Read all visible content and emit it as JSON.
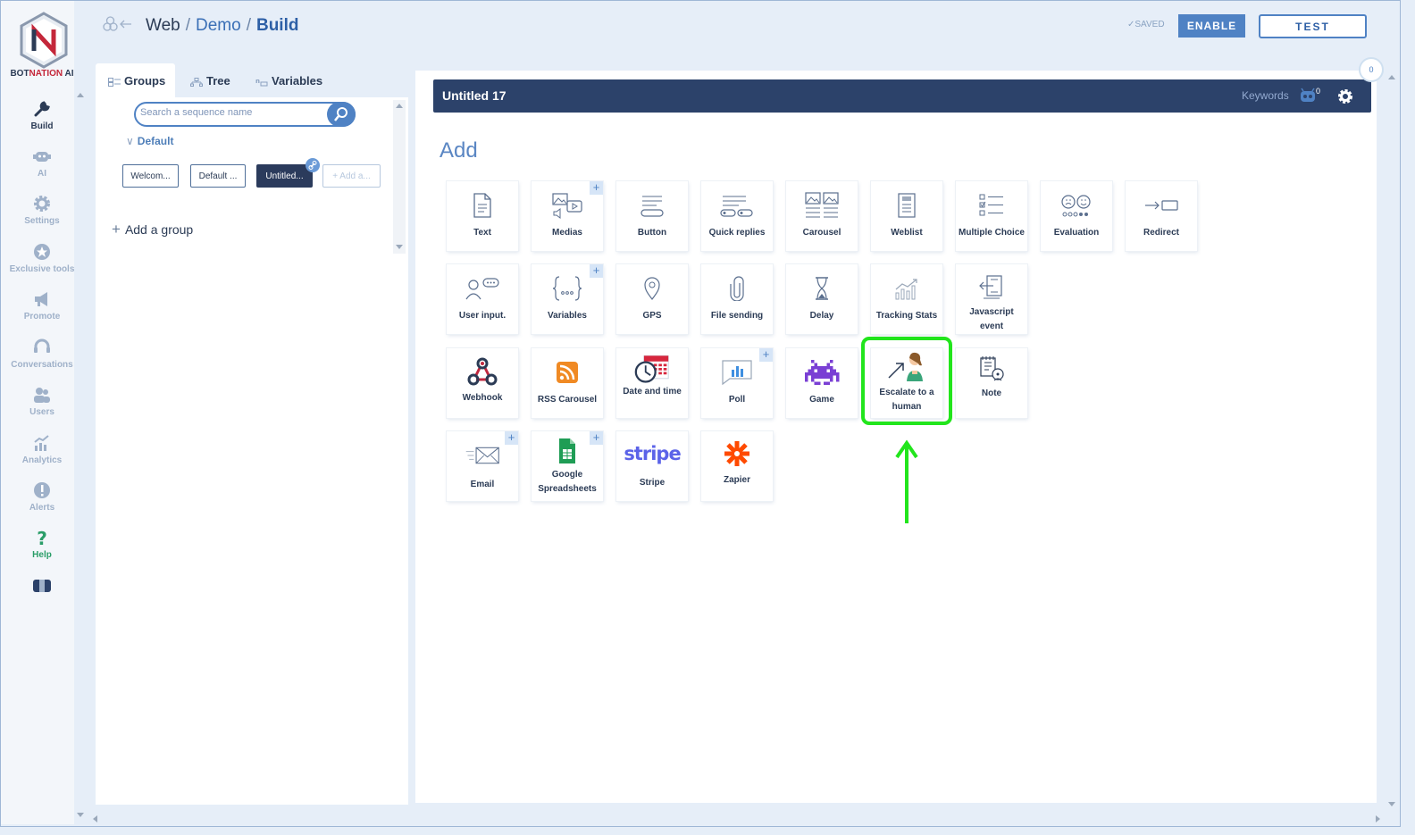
{
  "brand": {
    "name_part1": "BOT",
    "name_part2": "NATION",
    "name_part3": " AI"
  },
  "nav": {
    "build": "Build",
    "ai": "AI",
    "settings": "Settings",
    "exclusive": "Exclusive tools",
    "promote": "Promote",
    "conversations": "Conversations",
    "users": "Users",
    "analytics": "Analytics",
    "alerts": "Alerts",
    "help": "Help"
  },
  "breadcrumb": {
    "root": "Web",
    "mid": "Demo",
    "current": "Build",
    "sep": "/"
  },
  "top": {
    "saved": "SAVED",
    "enable": "ENABLE",
    "test": "TEST"
  },
  "tabs": {
    "groups": "Groups",
    "tree": "Tree",
    "variables": "Variables"
  },
  "groups": {
    "search_placeholder": "Search a sequence name",
    "folder": "Default",
    "chips": [
      "Welcom...",
      "Default ...",
      "Untitled...",
      "+ Add a..."
    ],
    "add_group": "Add a group"
  },
  "sequence": {
    "title": "Untitled 17",
    "keywords": "Keywords",
    "keywords_count": "0",
    "badge_count": "0"
  },
  "add_title": "Add",
  "tiles": {
    "text": "Text",
    "medias": "Medias",
    "button": "Button",
    "quick": "Quick replies",
    "carousel": "Carousel",
    "weblist": "Weblist",
    "multiple": "Multiple Choice",
    "evaluation": "Evaluation",
    "redirect": "Redirect",
    "userinput": "User input.",
    "variables": "Variables",
    "gps": "GPS",
    "filesending": "File sending",
    "delay": "Delay",
    "tracking": "Tracking Stats",
    "javascript": "Javascript event",
    "webhook": "Webhook",
    "rss": "RSS Carousel",
    "datetime": "Date and time",
    "poll": "Poll",
    "game": "Game",
    "escalate": "Escalate to a human",
    "note": "Note",
    "email": "Email",
    "gsheets": "Google Spreadsheets",
    "stripe": "Stripe",
    "stripe_logo": "stripe",
    "zapier": "Zapier",
    "plus": "+"
  },
  "colors": {
    "navy": "#2c426a",
    "accent": "#4f82c4",
    "highlight": "#22e51c"
  }
}
